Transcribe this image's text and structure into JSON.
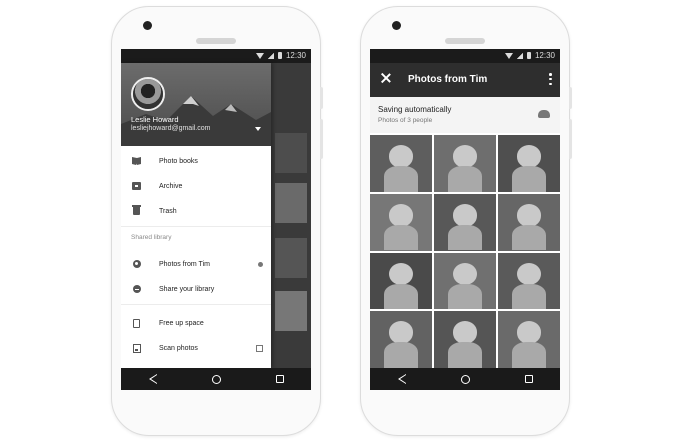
{
  "phone1": {
    "status": {
      "time": "12:30"
    },
    "account": {
      "name": "Leslie Howard",
      "email": "lesliejhoward@gmail.com"
    },
    "menu": {
      "photo_books": "Photo books",
      "archive": "Archive",
      "trash": "Trash",
      "shared_library_heading": "Shared library",
      "photos_from_tim": "Photos from Tim",
      "share_your_library": "Share your library",
      "free_up_space": "Free up space",
      "scan_photos": "Scan photos"
    },
    "icons": [
      "book-icon",
      "archive-icon",
      "trash-icon",
      "person-icon",
      "share-icon",
      "free-up-icon",
      "scan-icon",
      "external-link-icon"
    ]
  },
  "phone2": {
    "status": {
      "time": "12:30"
    },
    "appbar": {
      "title": "Photos from Tim"
    },
    "banner": {
      "title": "Saving automatically",
      "subtitle": "Photos of 3 people"
    },
    "photo_count": 12
  }
}
